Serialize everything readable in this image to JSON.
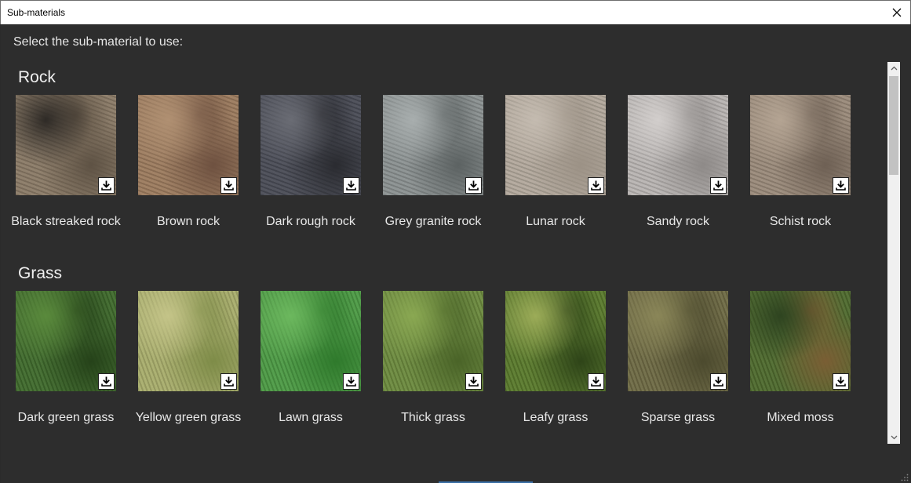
{
  "window": {
    "title": "Sub-materials"
  },
  "prompt": "Select the sub-material to use:",
  "sections": [
    {
      "title": "Rock",
      "items": [
        {
          "label": "Black streaked rock",
          "icon": "texture-black-streaked-rock",
          "colors": [
            "#8a7a66",
            "#5e5244",
            "#2e2a26"
          ]
        },
        {
          "label": "Brown rock",
          "icon": "texture-brown-rock",
          "colors": [
            "#9c7b5e",
            "#6e5140",
            "#b09072"
          ]
        },
        {
          "label": "Dark rough rock",
          "icon": "texture-dark-rough-rock",
          "colors": [
            "#4a4c56",
            "#2a2b30",
            "#6a6c74"
          ]
        },
        {
          "label": "Grey granite rock",
          "icon": "texture-grey-granite-rock",
          "colors": [
            "#8a9090",
            "#5c6262",
            "#a8aeae"
          ]
        },
        {
          "label": "Lunar rock",
          "icon": "texture-lunar-rock",
          "colors": [
            "#b2a89c",
            "#9c9286",
            "#c4bbb0"
          ]
        },
        {
          "label": "Sandy rock",
          "icon": "texture-sandy-rock",
          "colors": [
            "#b8b4b2",
            "#8e8a88",
            "#d2cecc"
          ]
        },
        {
          "label": "Schist rock",
          "icon": "texture-schist-rock",
          "colors": [
            "#9a8a7a",
            "#6e6054",
            "#b4a493"
          ]
        }
      ]
    },
    {
      "title": "Grass",
      "items": [
        {
          "label": "Dark green grass",
          "icon": "texture-dark-green-grass",
          "colors": [
            "#3f6a2c",
            "#254219",
            "#5a8a3c"
          ]
        },
        {
          "label": "Yellow green grass",
          "icon": "texture-yellow-green-grass",
          "colors": [
            "#a8ad6c",
            "#7e8c48",
            "#c4c488"
          ]
        },
        {
          "label": "Lawn grass",
          "icon": "texture-lawn-grass",
          "colors": [
            "#4c9a44",
            "#2f7a2c",
            "#6cb85e"
          ]
        },
        {
          "label": "Thick grass",
          "icon": "texture-thick-grass",
          "colors": [
            "#6c8a3e",
            "#4a6428",
            "#8aa852"
          ]
        },
        {
          "label": "Leafy grass",
          "icon": "texture-leafy-grass",
          "colors": [
            "#5a7a2c",
            "#2e4418",
            "#9cac58"
          ]
        },
        {
          "label": "Sparse grass",
          "icon": "texture-sparse-grass",
          "colors": [
            "#6e6a44",
            "#4c4a2e",
            "#8a8658"
          ]
        },
        {
          "label": "Mixed moss",
          "icon": "texture-mixed-moss",
          "colors": [
            "#4e6a2e",
            "#7a5e34",
            "#2e4420"
          ]
        }
      ]
    }
  ]
}
